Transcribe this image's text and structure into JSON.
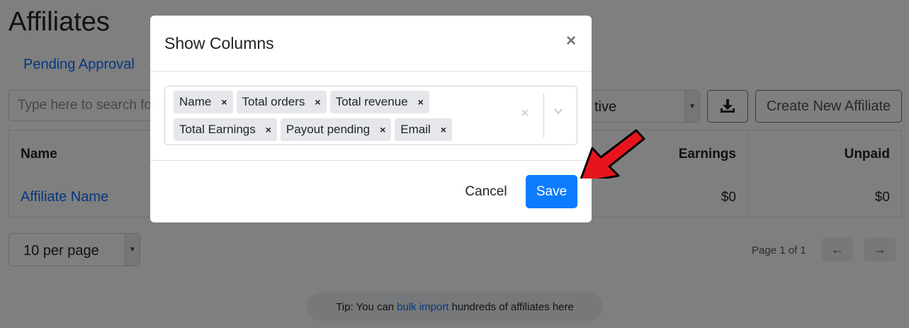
{
  "page": {
    "title": "Affiliates",
    "tab": "Pending Approval",
    "search_placeholder": "Type here to search fo",
    "status_value": "tive",
    "create_button": "Create New Affiliate",
    "download_icon": "download-tray-icon"
  },
  "table": {
    "headers": {
      "name": "Name",
      "earnings": "Earnings",
      "unpaid": "Unpaid"
    },
    "rows": [
      {
        "name": "Affiliate Name",
        "earnings": "$0",
        "unpaid": "$0"
      }
    ]
  },
  "pagination": {
    "per_page": "10 per page",
    "page_text": "Page 1 of 1",
    "prev": "←",
    "next": "→"
  },
  "tip": {
    "prefix": "Tip: You can",
    "link": "bulk import",
    "suffix": "hundreds of affiliates here"
  },
  "modal": {
    "title": "Show Columns",
    "close": "×",
    "chips": [
      {
        "label": "Name",
        "x": "×"
      },
      {
        "label": "Total orders",
        "x": "×"
      },
      {
        "label": "Total revenue",
        "x": "×"
      },
      {
        "label": "Total Earnings",
        "x": "×"
      },
      {
        "label": "Payout pending",
        "x": "×"
      },
      {
        "label": "Email",
        "x": "×"
      }
    ],
    "clear": "×",
    "cancel": "Cancel",
    "save": "Save"
  },
  "colors": {
    "primary": "#0d7bfd",
    "link": "#0d6efd",
    "arrow": "#e8141d"
  }
}
